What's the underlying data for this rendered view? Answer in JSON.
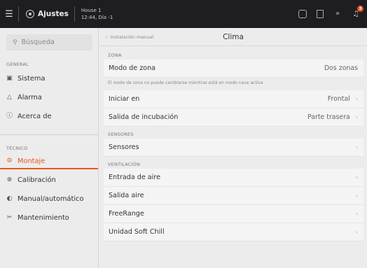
{
  "topbar": {
    "menu_icon": "hamburger-icon",
    "title": "Ajustes",
    "house_name": "House 1",
    "house_time": "12:44, Día -1",
    "alarm_count": "3"
  },
  "sidebar": {
    "search_placeholder": "Búsqueda",
    "general_label": "GENERAL",
    "tecnico_label": "TÉCNICO",
    "items": [
      {
        "label": "Sistema",
        "icon": "system-icon"
      },
      {
        "label": "Alarma",
        "icon": "bell-icon"
      },
      {
        "label": "Acerca de",
        "icon": "info-icon"
      },
      {
        "label": "Montaje",
        "icon": "installation-icon"
      },
      {
        "label": "Calibración",
        "icon": "calibration-icon"
      },
      {
        "label": "Manual/automático",
        "icon": "toggle-icon"
      },
      {
        "label": "Mantenimiento",
        "icon": "tools-icon"
      }
    ]
  },
  "header": {
    "back_label": "Instalación manual",
    "title": "Clima"
  },
  "sections": {
    "zona_label": "ZONA",
    "zona_note": "El modo de zona no puede cambiarse mientras está en modo nave activa",
    "sensores_label": "SENSORES",
    "ventilacion_label": "VENTILACIÓN"
  },
  "rows": {
    "modo_zona": {
      "label": "Modo de zona",
      "value": "Dos zonas"
    },
    "iniciar_en": {
      "label": "Iniciar en",
      "value": "Frontal"
    },
    "salida_incubacion": {
      "label": "Salida de incubación",
      "value": "Parte trasera"
    },
    "sensores": {
      "label": "Sensores"
    },
    "entrada_aire": {
      "label": "Entrada de aire"
    },
    "salida_aire": {
      "label": "Salida aire"
    },
    "freerange": {
      "label": "FreeRange"
    },
    "soft_chill": {
      "label": "Unidad Soft Chill"
    }
  },
  "colors": {
    "accent": "#e8561c",
    "topbar": "#1e1e22"
  }
}
